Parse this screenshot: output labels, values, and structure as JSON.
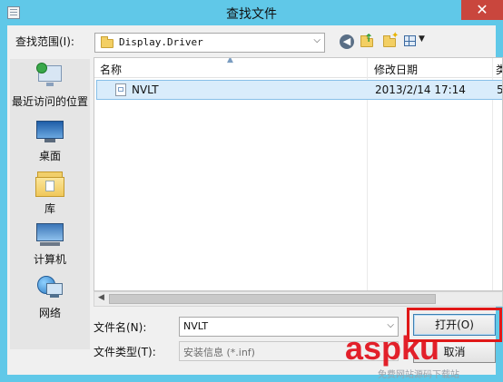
{
  "window": {
    "title": "查找文件",
    "close_glyph": "✕"
  },
  "lookin": {
    "label": "查找范围(I):",
    "value": "Display.Driver",
    "icons": [
      "back-icon",
      "up-folder-icon",
      "new-folder-icon",
      "view-menu-icon"
    ]
  },
  "places": [
    {
      "label": "最近访问的位置",
      "icon": "recent-places-icon"
    },
    {
      "label": "桌面",
      "icon": "desktop-icon"
    },
    {
      "label": "库",
      "icon": "libraries-icon"
    },
    {
      "label": "计算机",
      "icon": "computer-icon"
    },
    {
      "label": "网络",
      "icon": "network-icon"
    }
  ],
  "file_list": {
    "columns": [
      "名称",
      "修改日期",
      "类"
    ],
    "rows": [
      {
        "name": "NVLT",
        "date": "2013/2/14 17:14",
        "type": "5"
      }
    ]
  },
  "filename": {
    "label": "文件名(N):",
    "value": "NVLT"
  },
  "filetype": {
    "label": "文件类型(T):",
    "value": "安装信息 (*.inf)"
  },
  "buttons": {
    "open": "打开(O)",
    "cancel": "取消"
  },
  "watermark": {
    "main": "aspku",
    "sub": "免费网站源码下载站"
  },
  "colors": {
    "title_bar": "#60c8e8",
    "close_button": "#c9463d",
    "selection": "#d9ecfb",
    "highlight_box": "#e01818"
  }
}
